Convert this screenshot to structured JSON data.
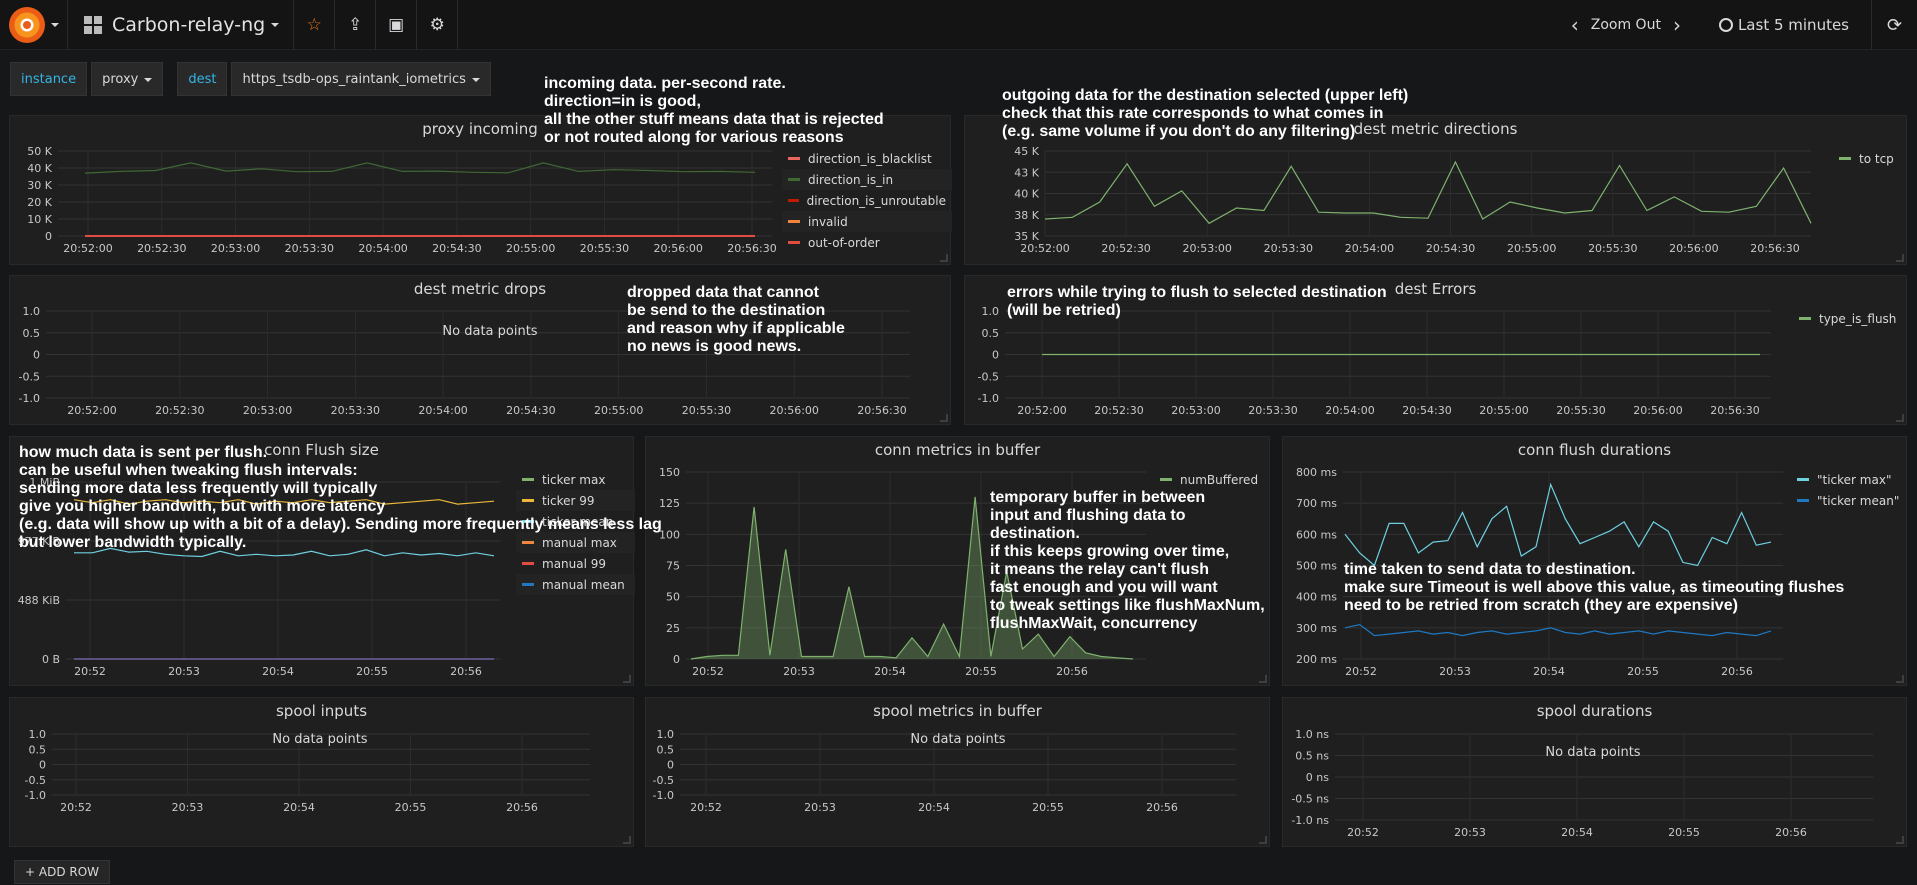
{
  "navbar": {
    "dashboard_title": "Carbon-relay-ng",
    "zoom_out": "Zoom Out",
    "time_range": "Last 5 minutes"
  },
  "templating": {
    "vars": [
      {
        "label": "instance",
        "value": "proxy"
      },
      {
        "label": "dest",
        "value": "https_tsdb-ops_raintank_iometrics"
      }
    ]
  },
  "panels": {
    "proxy_incoming": {
      "title": "proxy incoming",
      "y_ticks": [
        "50 K",
        "40 K",
        "30 K",
        "20 K",
        "10 K",
        "0"
      ],
      "x_ticks": [
        "20:52:00",
        "20:52:30",
        "20:53:00",
        "20:53:30",
        "20:54:00",
        "20:54:30",
        "20:55:00",
        "20:55:30",
        "20:56:00",
        "20:56:30"
      ],
      "legend": [
        "direction_is_blacklist",
        "direction_is_in",
        "direction_is_unroutable",
        "invalid",
        "out-of-order"
      ],
      "colors": [
        "#ea6460",
        "#3f6833",
        "#bf1b00",
        "#ef843c",
        "#e24d42"
      ]
    },
    "dest_metric_directions": {
      "title": "dest metric directions",
      "y_ticks": [
        "45 K",
        "43 K",
        "40 K",
        "38 K",
        "35 K"
      ],
      "x_ticks": [
        "20:52:00",
        "20:52:30",
        "20:53:00",
        "20:53:30",
        "20:54:00",
        "20:54:30",
        "20:55:00",
        "20:55:30",
        "20:56:00",
        "20:56:30"
      ],
      "legend": [
        "to tcp"
      ],
      "colors": [
        "#7eb26d"
      ]
    },
    "dest_metric_drops": {
      "title": "dest metric drops",
      "no_data": "No data points",
      "y_ticks": [
        "1.0",
        "0.5",
        "0",
        "-0.5",
        "-1.0"
      ],
      "x_ticks": [
        "20:52:00",
        "20:52:30",
        "20:53:00",
        "20:53:30",
        "20:54:00",
        "20:54:30",
        "20:55:00",
        "20:55:30",
        "20:56:00",
        "20:56:30"
      ]
    },
    "dest_errors": {
      "title": "dest Errors",
      "y_ticks": [
        "1.0",
        "0.5",
        "0",
        "-0.5",
        "-1.0"
      ],
      "x_ticks": [
        "20:52:00",
        "20:52:30",
        "20:53:00",
        "20:53:30",
        "20:54:00",
        "20:54:30",
        "20:55:00",
        "20:55:30",
        "20:56:00",
        "20:56:30"
      ],
      "legend": [
        "type_is_flush"
      ],
      "colors": [
        "#7eb26d"
      ]
    },
    "conn_flush_size": {
      "title": "conn Flush size",
      "y_ticks": [
        "1 MiB",
        "977 KiB",
        "488 KiB",
        "0 B"
      ],
      "x_ticks": [
        "20:52",
        "20:53",
        "20:54",
        "20:55",
        "20:56"
      ],
      "legend": [
        "ticker max",
        "ticker 99",
        "ticker mean",
        "manual max",
        "manual 99",
        "manual mean"
      ],
      "colors": [
        "#7eb26d",
        "#eab839",
        "#6ed0e0",
        "#ef843c",
        "#e24d42",
        "#1f78c1"
      ]
    },
    "conn_metrics_in_buffer": {
      "title": "conn metrics in buffer",
      "y_ticks": [
        "150",
        "125",
        "100",
        "75",
        "50",
        "25",
        "0"
      ],
      "x_ticks": [
        "20:52",
        "20:53",
        "20:54",
        "20:55",
        "20:56"
      ],
      "legend": [
        "numBuffered"
      ],
      "colors": [
        "#7eb26d"
      ]
    },
    "conn_flush_durations": {
      "title": "conn flush durations",
      "y_ticks": [
        "800 ms",
        "700 ms",
        "600 ms",
        "500 ms",
        "400 ms",
        "300 ms",
        "200 ms"
      ],
      "x_ticks": [
        "20:52",
        "20:53",
        "20:54",
        "20:55",
        "20:56"
      ],
      "legend": [
        "\"ticker max\"",
        "\"ticker mean\""
      ],
      "colors": [
        "#6ed0e0",
        "#1f78c1"
      ]
    },
    "spool_inputs": {
      "title": "spool inputs",
      "no_data": "No data points",
      "y_ticks": [
        "1.0",
        "0.5",
        "0",
        "-0.5",
        "-1.0"
      ],
      "x_ticks": [
        "20:52",
        "20:53",
        "20:54",
        "20:55",
        "20:56"
      ]
    },
    "spool_metrics_in_buffer": {
      "title": "spool metrics in buffer",
      "no_data": "No data points",
      "y_ticks": [
        "1.0",
        "0.5",
        "0",
        "-0.5",
        "-1.0"
      ],
      "x_ticks": [
        "20:52",
        "20:53",
        "20:54",
        "20:55",
        "20:56"
      ]
    },
    "spool_durations": {
      "title": "spool durations",
      "no_data": "No data points",
      "y_ticks": [
        "1.0 ns",
        "0.5 ns",
        "0 ns",
        "-0.5 ns",
        "-1.0 ns"
      ],
      "x_ticks": [
        "20:52",
        "20:53",
        "20:54",
        "20:55",
        "20:56"
      ]
    }
  },
  "notes": {
    "incoming": "incoming data. per-second rate.\ndirection=in is good,\nall the other stuff means data that is rejected\nor not routed along for various reasons",
    "outgoing": "outgoing data for the destination selected (upper left)\ncheck that this rate corresponds to what comes in\n(e.g. same volume if you don't do any filtering)",
    "dropped": "dropped data that cannot\nbe send to the destination\nand reason why if applicable\nno news is good news.",
    "errors": "errors while trying to flush to selected destination\n(will be retried)",
    "flush_size": "how much data is sent per flush.\ncan be useful when tweaking flush intervals:\nsending more data less frequently will typically\ngive you higher bandwith, but with more latency\n(e.g. data will show up with a bit of a delay). Sending more frequently means less lag\nbut lower bandwidth typically.",
    "buffer": "temporary buffer in between\ninput and flushing data to\ndestination.\nif this keeps growing over time,\nit means the relay can't flush\nfast enough and you will want\nto tweak settings like flushMaxNum,\nflushMaxWait, concurrency",
    "durations": "time taken to send data to destination.\nmake sure Timeout is well above this value, as timeouting flushes\nneed to be retried from scratch (they are expensive)"
  },
  "add_row": "ADD ROW",
  "chart_data": [
    {
      "type": "line",
      "title": "proxy incoming",
      "ylim": [
        0,
        50000
      ],
      "x": [
        "20:52:00",
        "20:52:15",
        "20:52:30",
        "20:52:45",
        "20:53:00",
        "20:53:15",
        "20:53:30",
        "20:53:45",
        "20:54:00",
        "20:54:15",
        "20:54:30",
        "20:54:45",
        "20:55:00",
        "20:55:15",
        "20:55:30",
        "20:55:45",
        "20:56:00",
        "20:56:15",
        "20:56:30",
        "20:56:45"
      ],
      "series": [
        {
          "name": "direction_is_in",
          "values": [
            37000,
            38000,
            38500,
            43000,
            38200,
            39500,
            37800,
            38000,
            43000,
            38000,
            38200,
            37500,
            37200,
            43000,
            38000,
            39000,
            38500,
            37800,
            38000,
            37500
          ]
        },
        {
          "name": "direction_is_blacklist",
          "values": [
            0,
            0,
            0,
            0,
            0,
            0,
            0,
            0,
            0,
            0,
            0,
            0,
            0,
            0,
            0,
            0,
            0,
            0,
            0,
            0
          ]
        }
      ]
    },
    {
      "type": "line",
      "title": "dest metric directions",
      "ylim": [
        35000,
        45000
      ],
      "x": [
        "20:52:00",
        "20:52:10",
        "20:52:20",
        "20:52:30",
        "20:52:40",
        "20:52:50",
        "20:53:00",
        "20:53:10",
        "20:53:20",
        "20:53:30",
        "20:53:40",
        "20:53:50",
        "20:54:00",
        "20:54:10",
        "20:54:20",
        "20:54:30",
        "20:54:40",
        "20:54:50",
        "20:55:00",
        "20:55:10",
        "20:55:20",
        "20:55:30",
        "20:55:40",
        "20:55:50",
        "20:56:00",
        "20:56:10",
        "20:56:20",
        "20:56:30",
        "20:56:40"
      ],
      "series": [
        {
          "name": "to tcp",
          "values": [
            37000,
            37200,
            39000,
            43500,
            38500,
            40300,
            36500,
            38300,
            38000,
            43200,
            37800,
            37700,
            37700,
            37200,
            37100,
            43700,
            37000,
            39000,
            38300,
            37700,
            38000,
            43300,
            38000,
            39600,
            37900,
            37800,
            38500,
            43000,
            36500
          ]
        }
      ]
    },
    {
      "type": "line",
      "title": "dest Errors",
      "ylim": [
        -1,
        1
      ],
      "series": [
        {
          "name": "type_is_flush",
          "values": [
            0,
            0
          ]
        }
      ]
    },
    {
      "type": "line",
      "title": "conn Flush size",
      "x": [
        "20:52",
        "20:53",
        "20:54",
        "20:55",
        "20:56"
      ],
      "series": [
        {
          "name": "ticker mean",
          "values": [
            720,
            720,
            750,
            725,
            730,
            710,
            700,
            695,
            730,
            700,
            710,
            700,
            705,
            730,
            700,
            710,
            740,
            700,
            720,
            705,
            715,
            700,
            720,
            700
          ]
        },
        {
          "name": "ticker 99",
          "values": [
            1080,
            1060,
            1080,
            1050,
            1070,
            1080,
            1060,
            1070,
            1060,
            1080,
            1050,
            1070,
            1060,
            1080,
            1060,
            1070,
            1080,
            1050,
            1060,
            1070,
            1080,
            1050,
            1060,
            1070
          ]
        },
        {
          "name": "manual mean",
          "values": [
            0,
            0
          ]
        }
      ]
    },
    {
      "type": "area",
      "title": "conn metrics in buffer",
      "ylim": [
        0,
        150
      ],
      "series": [
        {
          "name": "numBuffered",
          "values": [
            0,
            2,
            3,
            3,
            122,
            3,
            88,
            2,
            2,
            2,
            58,
            2,
            2,
            1,
            17,
            2,
            28,
            2,
            130,
            2,
            70,
            8,
            20,
            2,
            18,
            5,
            2,
            1,
            0
          ]
        }
      ]
    },
    {
      "type": "line",
      "title": "conn flush durations",
      "ylim": [
        200,
        800
      ],
      "series": [
        {
          "name": "\"ticker max\"",
          "values": [
            600,
            540,
            500,
            635,
            635,
            540,
            575,
            580,
            670,
            560,
            650,
            690,
            530,
            560,
            760,
            650,
            570,
            590,
            610,
            640,
            560,
            640,
            610,
            510,
            500,
            590,
            570,
            670,
            565,
            575
          ]
        },
        {
          "name": "\"ticker mean\"",
          "values": [
            300,
            310,
            275,
            280,
            285,
            290,
            280,
            285,
            275,
            285,
            290,
            280,
            285,
            290,
            300,
            285,
            280,
            290,
            280,
            285,
            290,
            280,
            290,
            285,
            280,
            275,
            285,
            280,
            275,
            290
          ]
        }
      ]
    }
  ]
}
